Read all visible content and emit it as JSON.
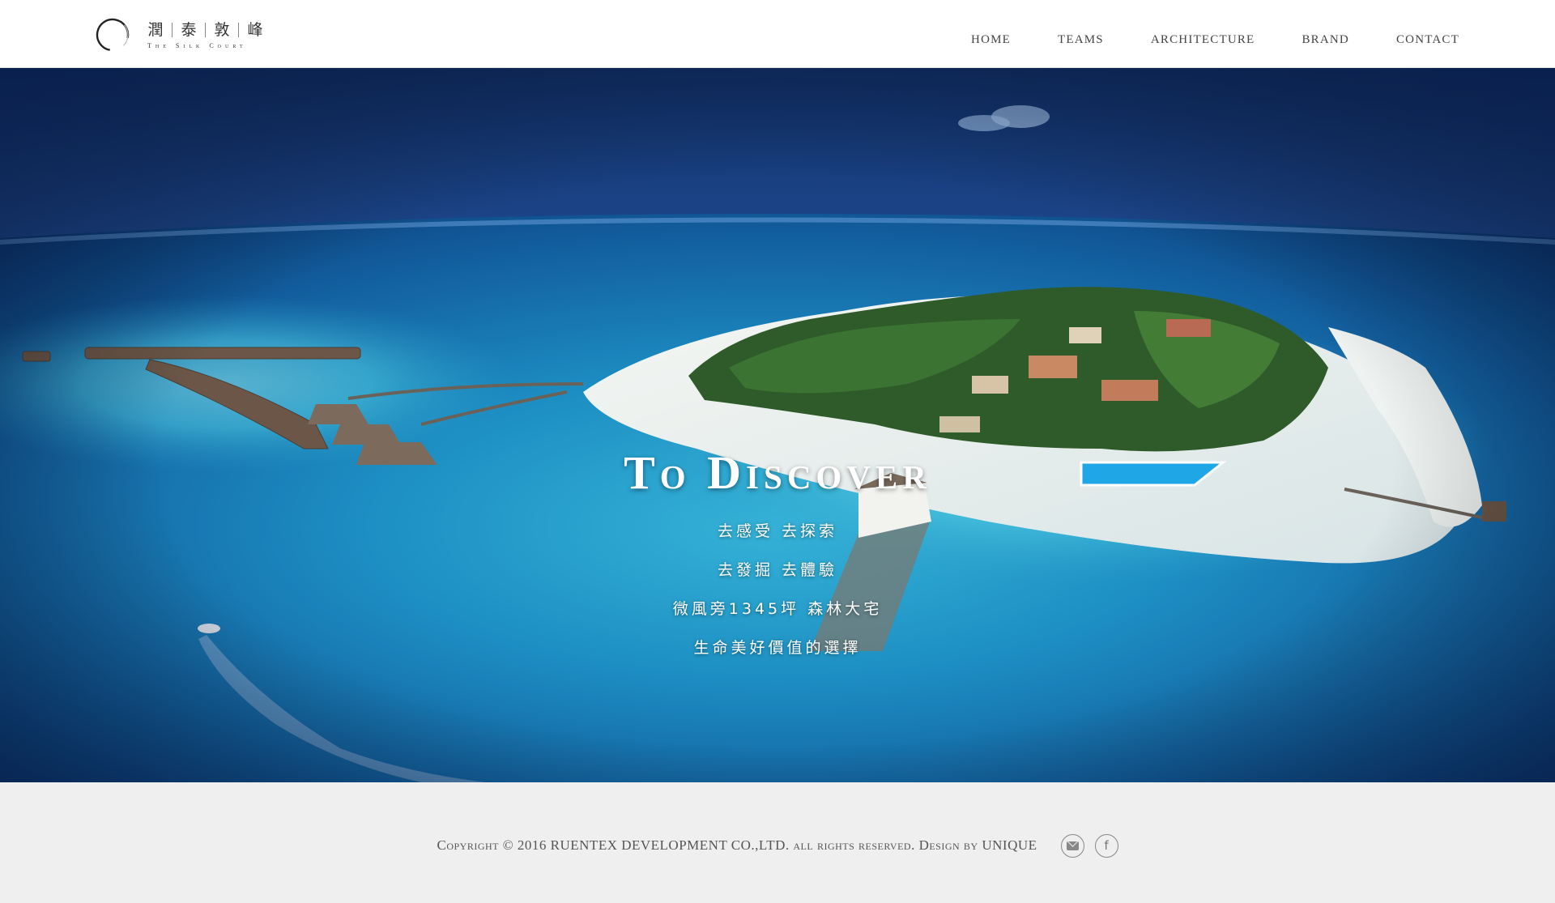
{
  "brand": {
    "chars": [
      "潤",
      "泰",
      "敦",
      "峰"
    ],
    "tagline": "The Silk Court"
  },
  "nav": {
    "items": [
      "HOME",
      "TEAMS",
      "ARCHITECTURE",
      "BRAND",
      "CONTACT"
    ]
  },
  "hero": {
    "title": "To Discover",
    "lines": [
      "去感受 去探索",
      "去發掘 去體驗",
      "微風旁1345坪 森林大宅",
      "生命美好價值的選擇"
    ],
    "image_icon": "tropical-island-photo"
  },
  "footer": {
    "copyright": "Copyright © 2016 RUENTEX DEVELOPMENT CO.,LTD. all rights reserved. Design by UNIQUE",
    "social": [
      "mail-icon",
      "facebook-icon"
    ]
  },
  "colors": {
    "header_bg": "#ffffff",
    "footer_bg": "#efefef",
    "ocean_deep": "#0d3f80",
    "lagoon": "#38b8d8"
  }
}
